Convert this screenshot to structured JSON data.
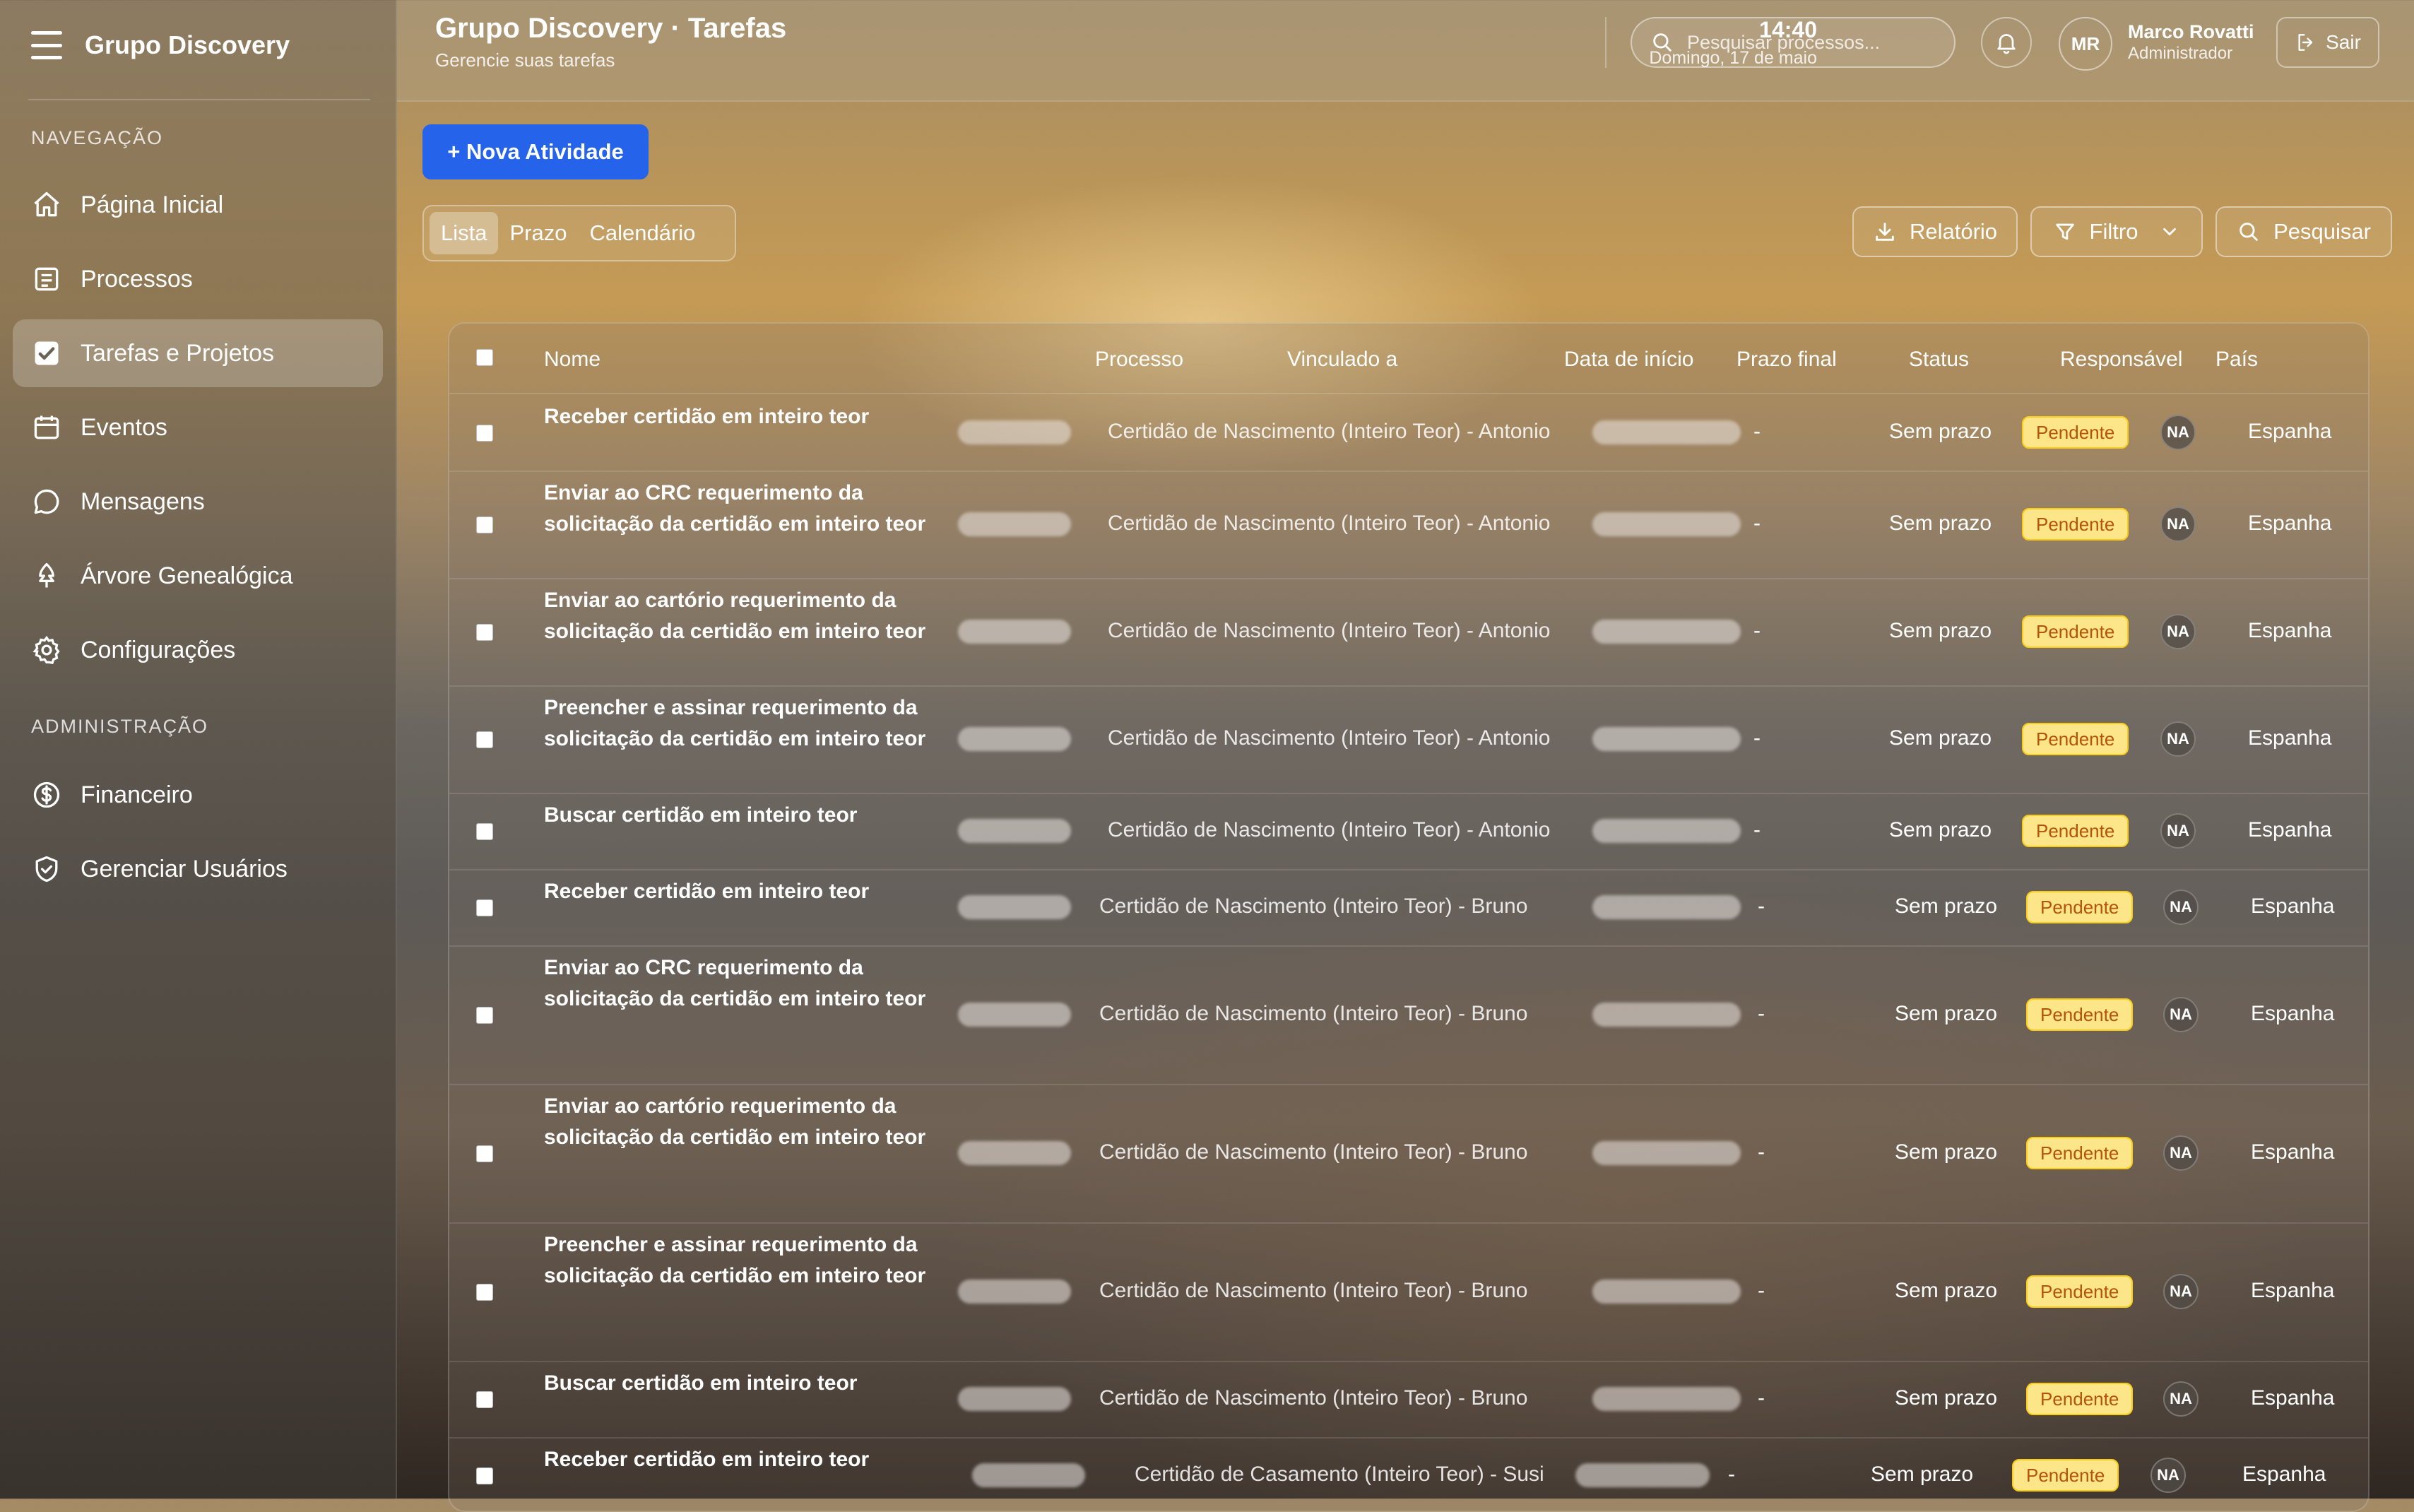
{
  "app": {
    "name": "Grupo Discovery"
  },
  "sidebar": {
    "section_nav": "NAVEGAÇÃO",
    "section_admin": "ADMINISTRAÇÃO",
    "items": [
      {
        "label": "Página Inicial",
        "icon": "home-icon"
      },
      {
        "label": "Processos",
        "icon": "document-list-icon"
      },
      {
        "label": "Tarefas e Projetos",
        "icon": "checkbox-icon",
        "active": true
      },
      {
        "label": "Eventos",
        "icon": "calendar-icon"
      },
      {
        "label": "Mensagens",
        "icon": "chat-bubble-icon"
      },
      {
        "label": "Árvore Genealógica",
        "icon": "tree-icon"
      },
      {
        "label": "Configurações",
        "icon": "gear-icon"
      }
    ],
    "admin_items": [
      {
        "label": "Financeiro",
        "icon": "dollar-icon"
      },
      {
        "label": "Gerenciar Usuários",
        "icon": "shield-icon"
      }
    ]
  },
  "header": {
    "title": "Grupo Discovery · Tarefas",
    "subtitle": "Gerencie suas tarefas",
    "time": "14:40",
    "date": "Domingo, 17 de maio",
    "search_placeholder": "Pesquisar processos...",
    "user": {
      "initials": "MR",
      "name": "Marco Rovatti",
      "role": "Administrador"
    },
    "logout_label": "Sair"
  },
  "toolbar": {
    "new_activity": "+ Nova Atividade",
    "tabs": [
      "Lista",
      "Prazo",
      "Calendário"
    ],
    "report": "Relatório",
    "filter": "Filtro",
    "search": "Pesquisar"
  },
  "table": {
    "columns": [
      "Nome",
      "Processo",
      "Vinculado a",
      "Data de início",
      "Prazo final",
      "Status",
      "Responsável",
      "País"
    ],
    "rows": [
      {
        "name": "Receber certidão em inteiro teor",
        "linked": "Certidão de Nascimento (Inteiro Teor) - Antonio",
        "start": "-",
        "deadline": "Sem prazo",
        "status": "Pendente",
        "owner": "NA",
        "country": "Espanha"
      },
      {
        "name": "Enviar ao CRC requerimento da solicitação da certidão em inteiro teor",
        "linked": "Certidão de Nascimento (Inteiro Teor) - Antonio",
        "start": "-",
        "deadline": "Sem prazo",
        "status": "Pendente",
        "owner": "NA",
        "country": "Espanha"
      },
      {
        "name": "Enviar ao cartório requerimento da solicitação da certidão em inteiro teor",
        "linked": "Certidão de Nascimento (Inteiro Teor) - Antonio",
        "start": "-",
        "deadline": "Sem prazo",
        "status": "Pendente",
        "owner": "NA",
        "country": "Espanha"
      },
      {
        "name": "Preencher e assinar requerimento da solicitação da certidão em inteiro teor",
        "linked": "Certidão de Nascimento (Inteiro Teor) - Antonio",
        "start": "-",
        "deadline": "Sem prazo",
        "status": "Pendente",
        "owner": "NA",
        "country": "Espanha"
      },
      {
        "name": "Buscar certidão em inteiro teor",
        "linked": "Certidão de Nascimento (Inteiro Teor) - Antonio",
        "start": "-",
        "deadline": "Sem prazo",
        "status": "Pendente",
        "owner": "NA",
        "country": "Espanha"
      },
      {
        "name": "Receber certidão em inteiro teor",
        "linked": "Certidão de Nascimento (Inteiro Teor) - Bruno",
        "start": "-",
        "deadline": "Sem prazo",
        "status": "Pendente",
        "owner": "NA",
        "country": "Espanha"
      },
      {
        "name": "Enviar ao CRC requerimento da solicitação da certidão em inteiro teor",
        "linked": "Certidão de Nascimento (Inteiro Teor) - Bruno",
        "start": "-",
        "deadline": "Sem prazo",
        "status": "Pendente",
        "owner": "NA",
        "country": "Espanha"
      },
      {
        "name": "Enviar ao cartório requerimento da solicitação da certidão em inteiro teor",
        "linked": "Certidão de Nascimento (Inteiro Teor) - Bruno",
        "start": "-",
        "deadline": "Sem prazo",
        "status": "Pendente",
        "owner": "NA",
        "country": "Espanha"
      },
      {
        "name": "Preencher e assinar requerimento da solicitação da certidão em inteiro teor",
        "linked": "Certidão de Nascimento (Inteiro Teor) - Bruno",
        "start": "-",
        "deadline": "Sem prazo",
        "status": "Pendente",
        "owner": "NA",
        "country": "Espanha"
      },
      {
        "name": "Buscar certidão em inteiro teor",
        "linked": "Certidão de Nascimento (Inteiro Teor) - Bruno",
        "start": "-",
        "deadline": "Sem prazo",
        "status": "Pendente",
        "owner": "NA",
        "country": "Espanha"
      },
      {
        "name": "Receber certidão em inteiro teor",
        "linked": "Certidão de Casamento (Inteiro Teor) - Susi",
        "start": "-",
        "deadline": "Sem prazo",
        "status": "Pendente",
        "owner": "NA",
        "country": "Espanha"
      }
    ]
  }
}
